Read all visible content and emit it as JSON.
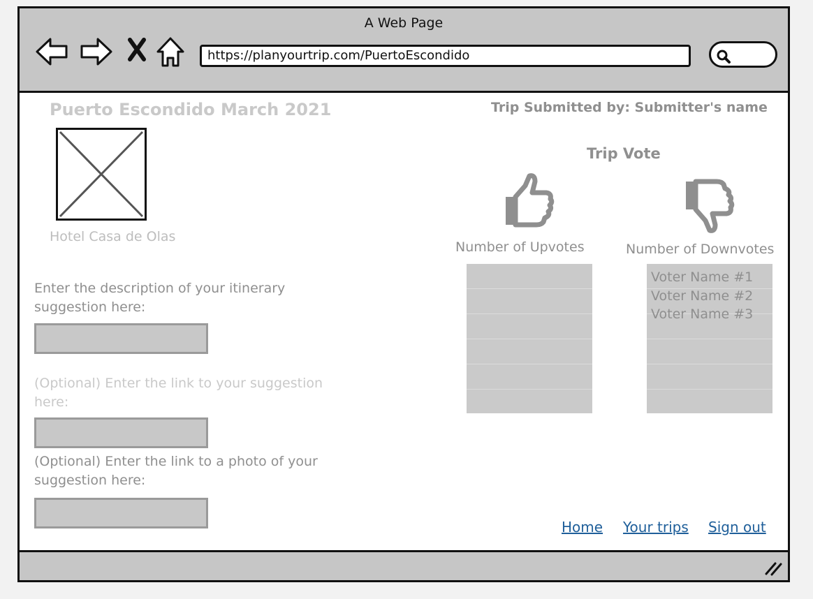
{
  "window": {
    "title": "A Web Page"
  },
  "browser": {
    "url": "https://planyourtrip.com/PuertoEscondido",
    "nav_icons": [
      "back-arrow-icon",
      "forward-arrow-icon",
      "stop-icon",
      "home-icon"
    ],
    "search_icon": "search-icon"
  },
  "trip": {
    "title": "Puerto Escondido March 2021",
    "submitted_by": "Trip Submitted by: Submitter's name",
    "hotel": "Hotel Casa de Olas"
  },
  "form": {
    "description_label": "Enter the description of your itinerary suggestion here:",
    "link_label": "(Optional) Enter the link to your suggestion here:",
    "photo_label": "(Optional) Enter the link to a photo of your suggestion here:"
  },
  "vote": {
    "title": "Trip Vote",
    "upvotes_label": "Number of Upvotes",
    "downvotes_label": "Number of Downvotes",
    "upvoters": [],
    "downvoters": [
      "Voter Name #1",
      "Voter Name #2",
      "Voter Name #3"
    ]
  },
  "footer_links": {
    "home": "Home",
    "your_trips": "Your trips",
    "sign_out": "Sign out"
  },
  "colors": {
    "frame": "#111111",
    "chrome": "#c6c6c6",
    "muted_text": "#8f8f8f",
    "link": "#1f5f9a"
  }
}
